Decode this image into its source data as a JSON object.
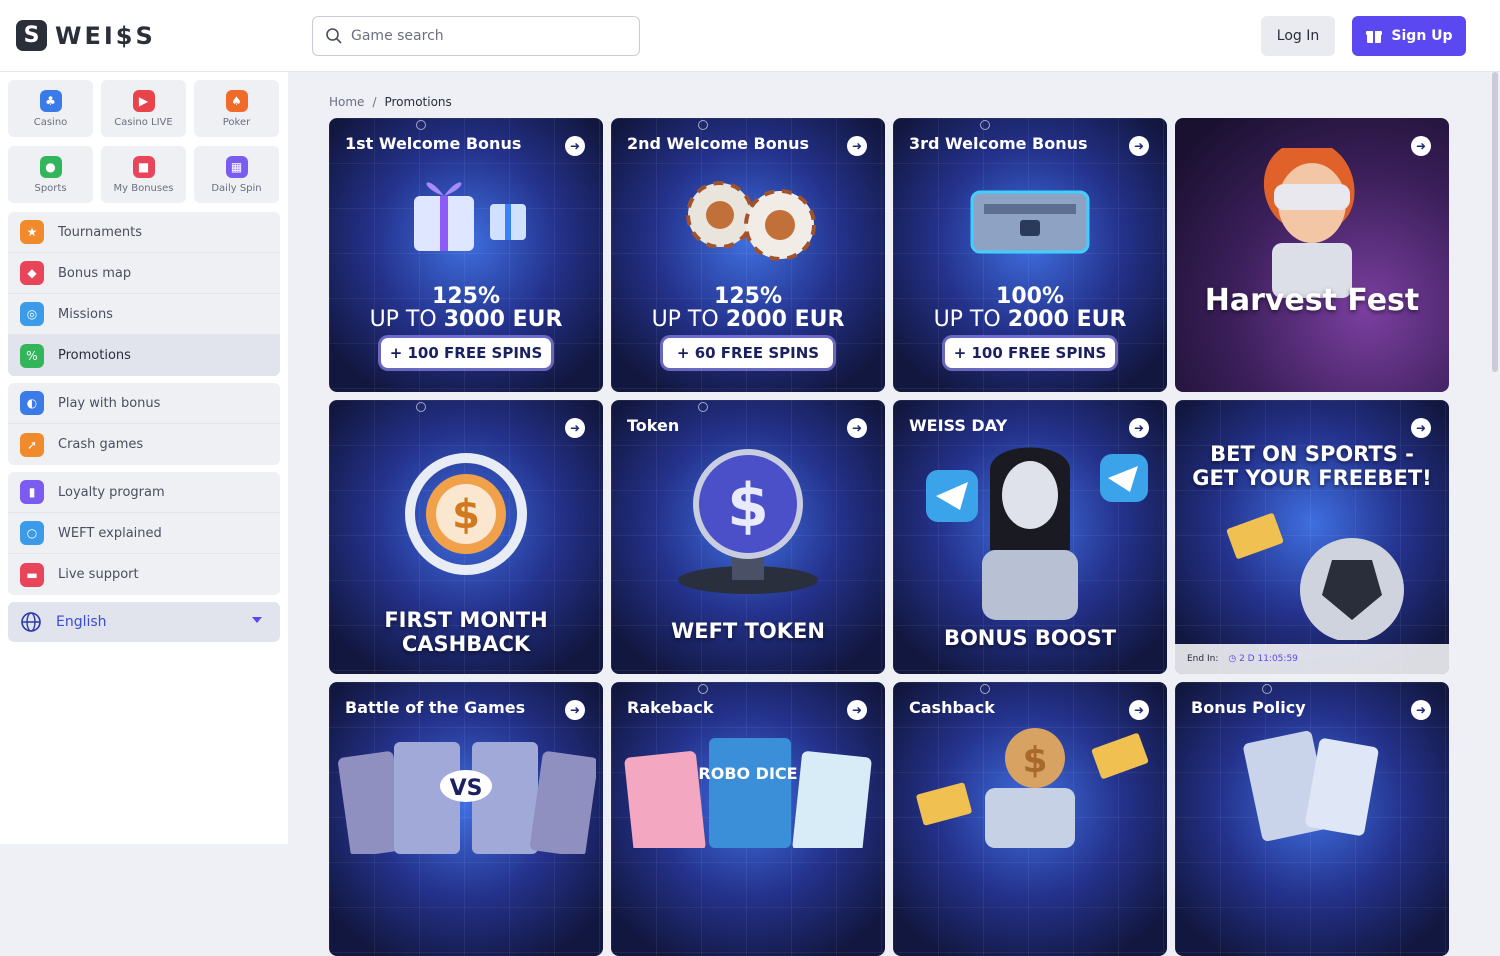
{
  "brand": {
    "logo_mark": "S",
    "logo_text": "WEI$S"
  },
  "search": {
    "placeholder": "Game search"
  },
  "auth": {
    "login": "Log In",
    "signup": "Sign Up"
  },
  "tiles": [
    {
      "label": "Casino",
      "icon": "casino-icon",
      "color": "#3b7be8"
    },
    {
      "label": "Casino LIVE",
      "icon": "live-icon",
      "color": "#e8444a"
    },
    {
      "label": "Poker",
      "icon": "poker-icon",
      "color": "#f06a2a"
    },
    {
      "label": "Sports",
      "icon": "sports-icon",
      "color": "#33b55b"
    },
    {
      "label": "My Bonuses",
      "icon": "gift-icon",
      "color": "#e8445a"
    },
    {
      "label": "Daily Spin",
      "icon": "spin-icon",
      "color": "#7b5cf0"
    }
  ],
  "menu_main": [
    {
      "label": "Tournaments",
      "icon": "trophy-icon",
      "color": "#f08a2a"
    },
    {
      "label": "Bonus map",
      "icon": "map-icon",
      "color": "#e8445a"
    },
    {
      "label": "Missions",
      "icon": "target-icon",
      "color": "#3b9be8"
    },
    {
      "label": "Promotions",
      "icon": "ticket-icon",
      "color": "#33b55b"
    }
  ],
  "menu_play": [
    {
      "label": "Play with bonus",
      "icon": "bonus-icon",
      "color": "#3b7be8"
    },
    {
      "label": "Crash games",
      "icon": "rocket-icon",
      "color": "#f08a2a"
    }
  ],
  "menu_info": [
    {
      "label": "Loyalty program",
      "icon": "loyalty-icon",
      "color": "#7b5cf0"
    },
    {
      "label": "WEFT explained",
      "icon": "coin-icon",
      "color": "#3b9be8"
    },
    {
      "label": "Live support",
      "icon": "chat-icon",
      "color": "#e8445a"
    }
  ],
  "language": {
    "label": "English"
  },
  "breadcrumb": {
    "home": "Home",
    "sep": "/",
    "current": "Promotions"
  },
  "cards": [
    {
      "title": "1st Welcome Bonus",
      "percent": "125%",
      "upto": "UP TO",
      "amount": "3000 EUR",
      "spins": "+ 100 FREE SPINS"
    },
    {
      "title": "2nd Welcome Bonus",
      "percent": "125%",
      "upto": "UP TO",
      "amount": "2000 EUR",
      "spins": "+ 60 FREE SPINS"
    },
    {
      "title": "3rd Welcome Bonus",
      "percent": "100%",
      "upto": "UP TO",
      "amount": "2000 EUR",
      "spins": "+ 100 FREE SPINS"
    },
    {
      "title": "",
      "bottom": "Harvest Fest"
    },
    {
      "title": "",
      "bottom": "FIRST MONTH CASHBACK"
    },
    {
      "title": "Token",
      "bottom": "WEFT TOKEN"
    },
    {
      "title": "WEISS DAY",
      "bottom": "BONUS BOOST"
    },
    {
      "title": "",
      "top": "BET ON SPORTS - GET YOUR FREEBET!",
      "end_label": "End In:",
      "end_time": "2 D  11:05:59"
    },
    {
      "title": "Battle of the Games",
      "badge": "VS"
    },
    {
      "title": "Rakeback",
      "badge": "ROBO DICE"
    },
    {
      "title": "Cashback"
    },
    {
      "title": "Bonus Policy"
    }
  ]
}
